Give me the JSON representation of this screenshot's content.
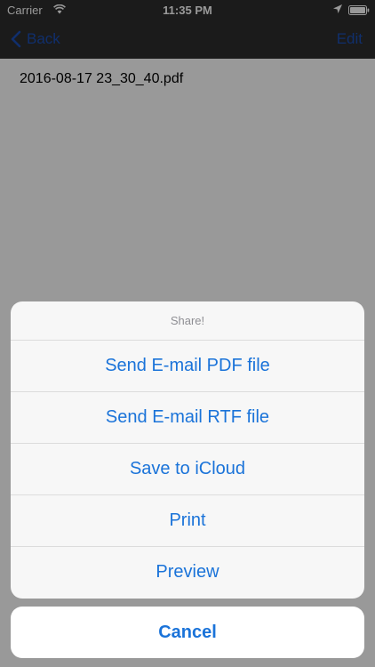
{
  "status_bar": {
    "carrier": "Carrier",
    "time": "11:35 PM"
  },
  "nav": {
    "back_label": "Back",
    "edit_label": "Edit"
  },
  "files": [
    {
      "name": "2016-08-17 23_30_40.pdf"
    }
  ],
  "action_sheet": {
    "title": "Share!",
    "actions": [
      {
        "label": "Send E-mail PDF file"
      },
      {
        "label": "Send E-mail RTF file"
      },
      {
        "label": "Save to iCloud"
      },
      {
        "label": "Print"
      },
      {
        "label": "Preview"
      }
    ],
    "cancel_label": "Cancel"
  },
  "colors": {
    "tint": "#1a73d9",
    "nav_background": "#2d2d2d",
    "title_gray": "#8e8e93"
  }
}
